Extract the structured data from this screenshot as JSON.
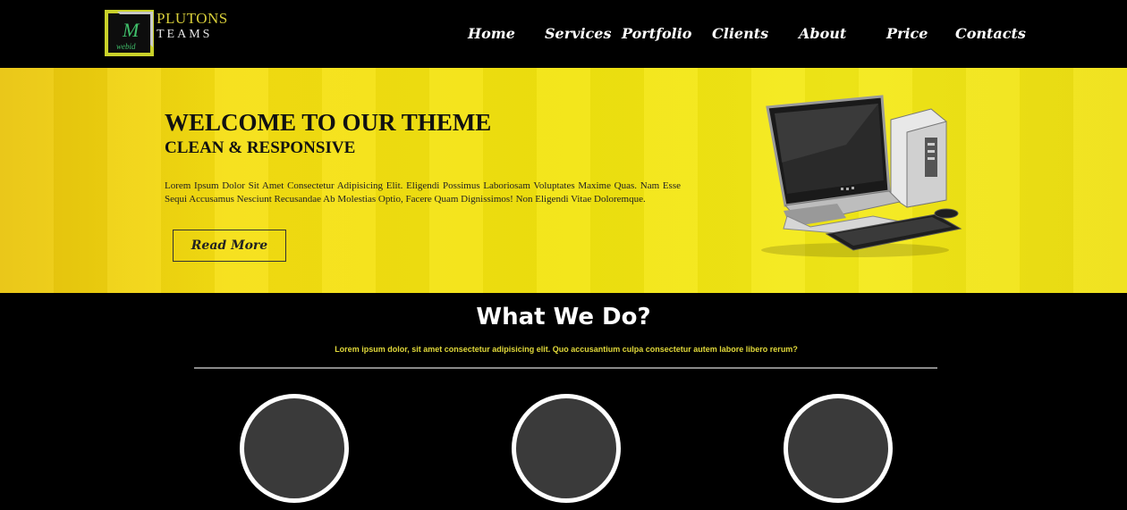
{
  "logo": {
    "letter": "M",
    "small_text": "webid",
    "line1": "PLUTONS",
    "line2": "TEAMS"
  },
  "nav": {
    "items": [
      "Home",
      "Services",
      "Portfolio",
      "Clients",
      "About",
      "Price",
      "Contacts"
    ]
  },
  "hero": {
    "title": "WELCOME TO OUR THEME",
    "subtitle": "CLEAN & RESPONSIVE",
    "text": "Lorem Ipsum Dolor Sit Amet Consectetur Adipisicing Elit. Eligendi Possimus Laboriosam Voluptates Maxime Quas. Nam Esse Sequi Accusamus Nesciunt Recusandae Ab Molestias Optio, Facere Quam Dignissimos! Non Eligendi Vitae Doloremque.",
    "button_label": "Read More"
  },
  "what_we_do": {
    "title": "What We Do?",
    "text": "Lorem ipsum dolor, sit amet consectetur adipisicing elit. Quo accusantium culpa consectetur autem labore libero rerum?"
  },
  "colors": {
    "accent_yellow": "#f2e40e",
    "logo_border": "#c9d12a",
    "background": "#000000",
    "circle_fill": "#3a3a3a"
  }
}
